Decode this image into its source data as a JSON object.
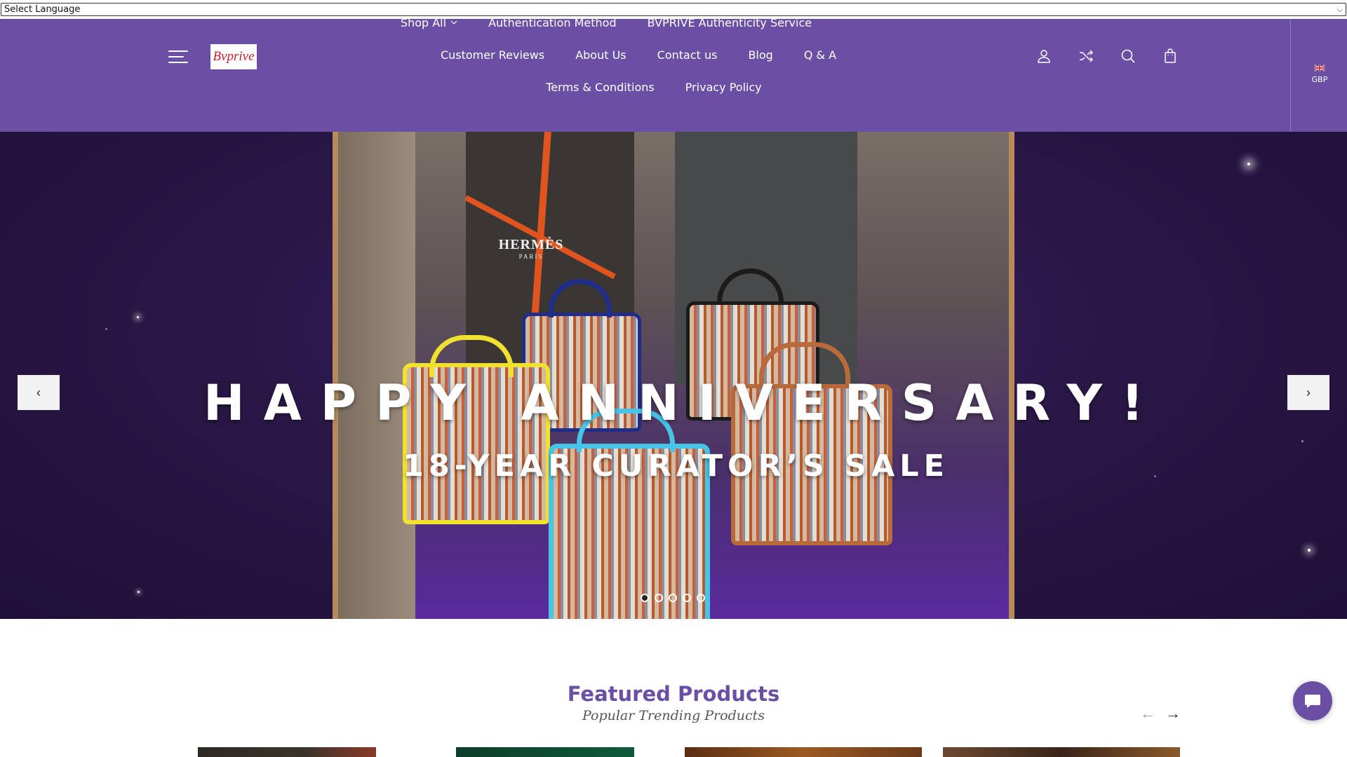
{
  "language_select": {
    "value": "Select Language"
  },
  "header": {
    "logo_text": "Bvprive",
    "nav": {
      "row1": [
        "Shop All",
        "Authentication Method",
        "BVPRIVE Authenticity Service"
      ],
      "row2": [
        "Customer Reviews",
        "About Us",
        "Contact us",
        "Blog",
        "Q & A"
      ],
      "row3": [
        "Terms & Conditions",
        "Privacy Policy"
      ]
    },
    "icons": [
      "user-icon",
      "shuffle-icon",
      "search-icon",
      "shopping-bag-icon"
    ],
    "currency": {
      "code": "GBP",
      "flag": "uk-flag-icon"
    },
    "background_color": "#6a4fa4"
  },
  "hero": {
    "title": "HAPPY ANNIVERSARY!",
    "subtitle": "18-YEAR CURATOR’S SALE",
    "photo_brand": "HERMÈS",
    "photo_brand_sub": "PARIS",
    "prev_label": "‹",
    "next_label": "›",
    "slide_count": 5,
    "active_slide": 1
  },
  "featured": {
    "title": "Featured Products",
    "subtitle": "Popular Trending Products",
    "prev_arrow": "←",
    "next_arrow": "→"
  },
  "chat": {
    "icon": "chat-bubble-icon"
  }
}
